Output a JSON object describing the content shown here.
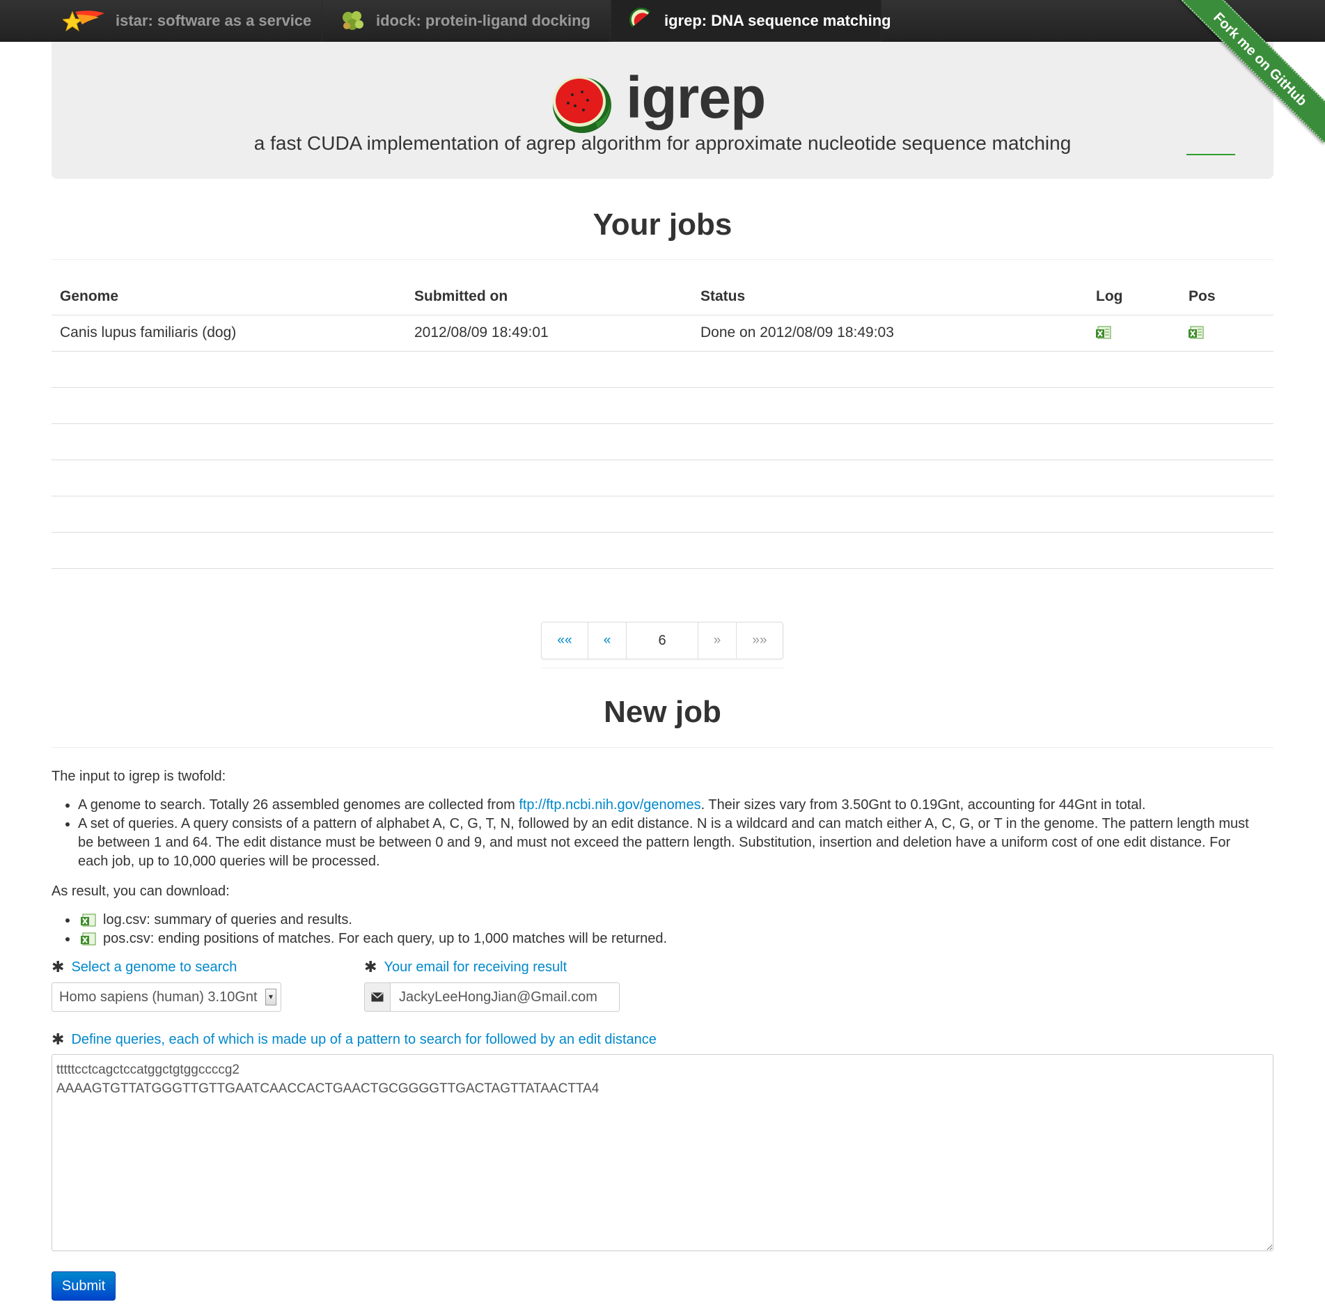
{
  "nav": {
    "items": [
      {
        "label": "istar: software as a service",
        "icon": "shooting-star-icon",
        "active": false
      },
      {
        "label": "idock: protein-ligand docking",
        "icon": "molecule-icon",
        "active": false
      },
      {
        "label": "igrep: DNA sequence matching",
        "icon": "watermelon-icon",
        "active": true
      }
    ],
    "ribbon": "Fork me on GitHub"
  },
  "hero": {
    "title": "igrep",
    "subtitle": "a fast CUDA implementation of agrep algorithm for approximate nucleotide sequence matching"
  },
  "jobs": {
    "heading": "Your jobs",
    "columns": [
      "Genome",
      "Submitted on",
      "Status",
      "Log",
      "Pos"
    ],
    "rows": [
      {
        "genome": "Canis lupus familiaris (dog)",
        "submitted": "2012/08/09 18:49:01",
        "status": "Done on 2012/08/09 18:49:03"
      }
    ]
  },
  "pagination": {
    "first": "««",
    "prev": "«",
    "page": "6",
    "next": "»",
    "last": "»»"
  },
  "newjob": {
    "heading": "New job",
    "intro": "The input to igrep is twofold:",
    "bullet1_pre": "A genome to search. Totally 26 assembled genomes are collected from ",
    "bullet1_link": "ftp://ftp.ncbi.nih.gov/genomes",
    "bullet1_post": ". Their sizes vary from 3.50Gnt to 0.19Gnt, accounting for 44Gnt in total.",
    "bullet2": "A set of queries. A query consists of a pattern of alphabet A, C, G, T, N, followed by an edit distance. N is a wildcard and can match either A, C, G, or T in the genome. The pattern length must be between 1 and 64. The edit distance must be between 0 and 9, and must not exceed the pattern length. Substitution, insertion and deletion have a uniform cost of one edit distance. For each job, up to 10,000 queries will be processed.",
    "result_intro": "As result, you can download:",
    "download1": "log.csv: summary of queries and results.",
    "download2": "pos.csv: ending positions of matches. For each query, up to 1,000 matches will be returned."
  },
  "form": {
    "genome_label": "Select a genome to search",
    "genome_value": "Homo sapiens (human) 3.10Gnt",
    "email_label": "Your email for receiving result",
    "email_value": "JackyLeeHongJian@Gmail.com",
    "queries_label": "Define queries, each of which is made up of a pattern to search for followed by an edit distance",
    "queries_value": "tttttcctcagctccatggctgtggccccg2\nAAAAGTGTTATGGGTTGTTGAATCAACCACTGAACTGCGGGGTTGACTAGTTATAACTTA4",
    "submit_label": "Submit"
  },
  "colors": {
    "link": "#0088cc",
    "navbar": "#222222",
    "ribbon": "#3a8d3a",
    "button": "#0055cc"
  }
}
